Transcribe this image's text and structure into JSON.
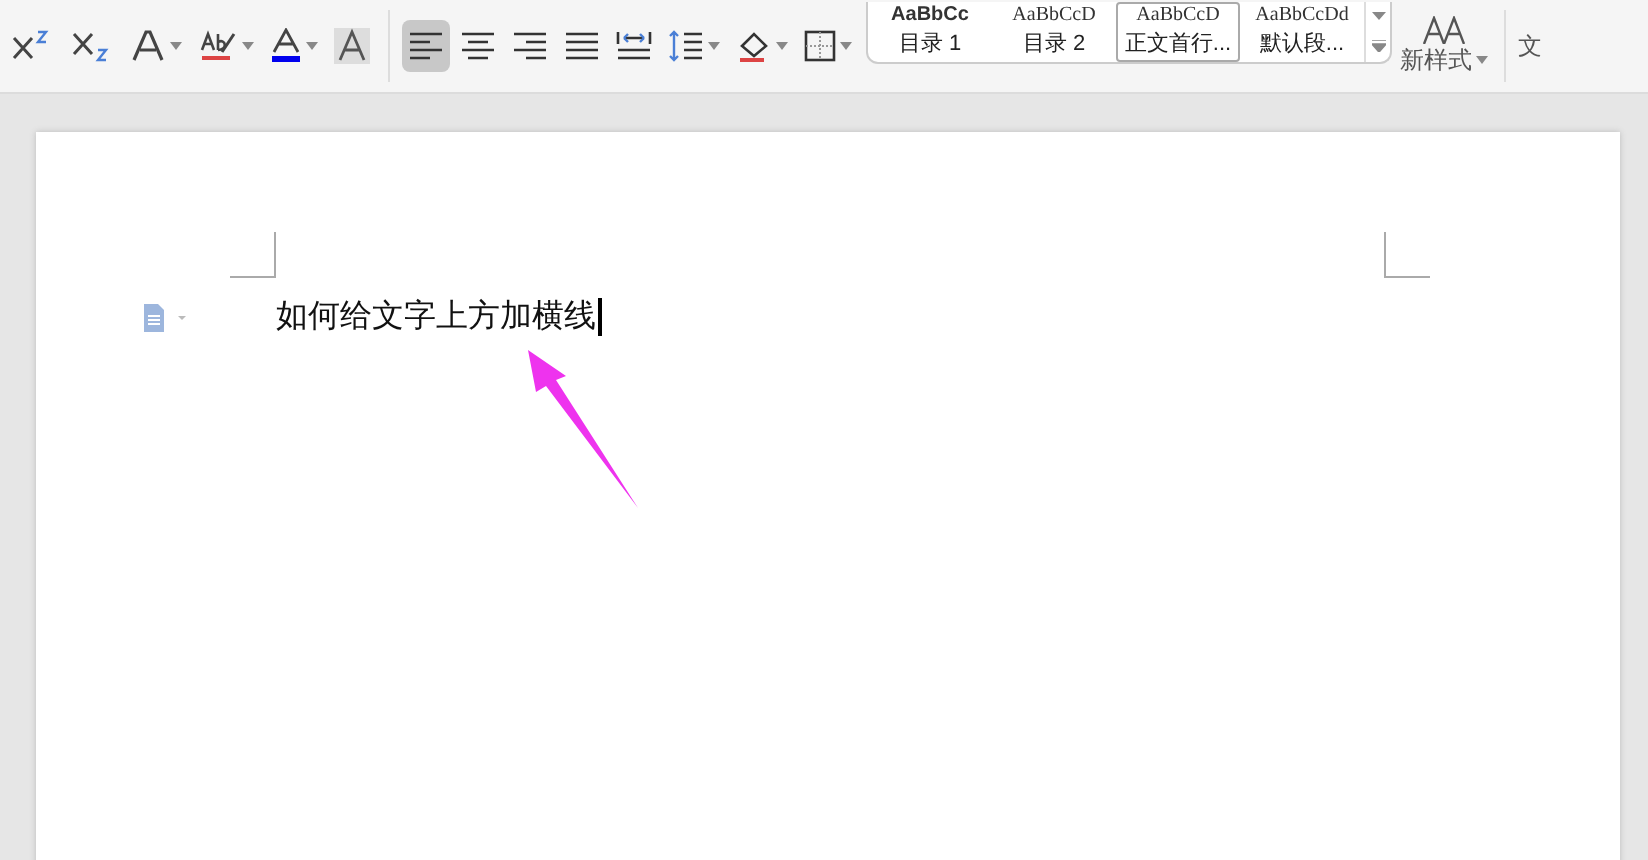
{
  "toolbar": {
    "font_tools": [
      {
        "kind": "superscript",
        "dropdown": false,
        "selected": false
      },
      {
        "kind": "subscript",
        "dropdown": false,
        "selected": false
      },
      {
        "kind": "text-effect",
        "dropdown": true,
        "selected": false
      },
      {
        "kind": "highlight",
        "dropdown": true,
        "selected": false
      },
      {
        "kind": "font-color",
        "dropdown": true,
        "selected": false
      },
      {
        "kind": "char-shading",
        "dropdown": false,
        "selected": false
      }
    ],
    "paragraph_tools": [
      {
        "kind": "align-left",
        "dropdown": false,
        "selected": true
      },
      {
        "kind": "align-center",
        "dropdown": false,
        "selected": false
      },
      {
        "kind": "align-right",
        "dropdown": false,
        "selected": false
      },
      {
        "kind": "justify",
        "dropdown": false,
        "selected": false
      },
      {
        "kind": "distribute",
        "dropdown": false,
        "selected": false
      },
      {
        "kind": "line-spacing",
        "dropdown": true,
        "selected": false
      },
      {
        "kind": "fill",
        "dropdown": true,
        "selected": false
      },
      {
        "kind": "borders",
        "dropdown": true,
        "selected": false
      }
    ],
    "styles": [
      {
        "preview": "AaBbCc",
        "label": "目录 1",
        "selected": false
      },
      {
        "preview": "AaBbCcD",
        "label": "目录 2",
        "selected": false
      },
      {
        "preview": "AaBbCcD",
        "label": "正文首行...",
        "selected": true
      },
      {
        "preview": "AaBbCcDd",
        "label": "默认段...",
        "selected": false
      }
    ],
    "new_style": "新样式",
    "cut_label": "文"
  },
  "document": {
    "text": "如何给文字上方加横线"
  }
}
